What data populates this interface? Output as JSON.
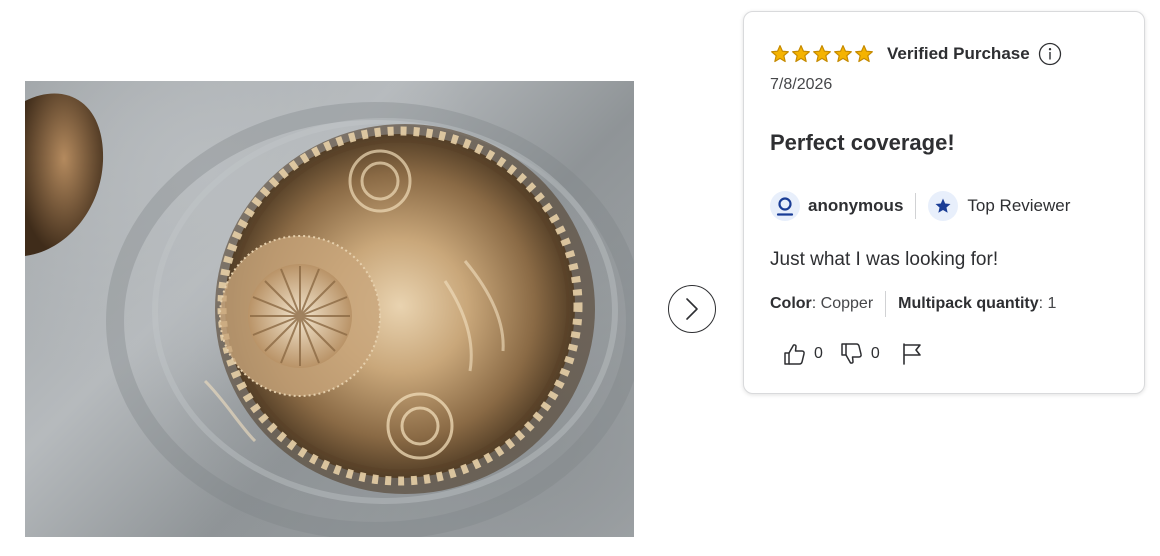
{
  "photo": {
    "alt": ""
  },
  "navigation": {
    "next_icon": "chevron-right-icon"
  },
  "review": {
    "rating": 5,
    "rating_max": 5,
    "star_color": "#f5b301",
    "verified_label": "Verified Purchase",
    "info_icon": "info-circle-icon",
    "date": "7/8/2026",
    "title": "Perfect coverage!",
    "author": {
      "name": "anonymous",
      "icon": "user-icon"
    },
    "badge": {
      "label": "Top Reviewer",
      "icon": "star-badge-icon"
    },
    "body": "Just what I was looking for!",
    "attributes": [
      {
        "key": "Color",
        "value": "Copper"
      },
      {
        "key": "Multipack quantity",
        "value": "1"
      }
    ],
    "actions": {
      "helpful_count": "0",
      "unhelpful_count": "0",
      "report_icon": "flag-icon"
    }
  },
  "colors": {
    "accent": "#1a3d96",
    "badge_bg": "#e8effb"
  }
}
